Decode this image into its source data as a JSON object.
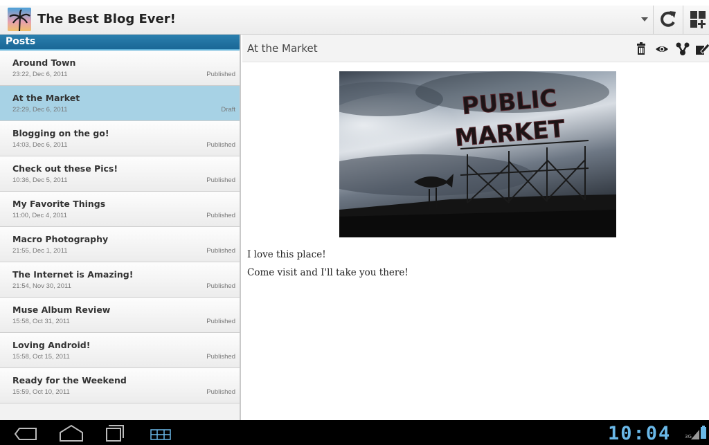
{
  "app": {
    "title": "The Best Blog Ever!"
  },
  "posts_header": "Posts",
  "posts": [
    {
      "title": "Around Town",
      "date": "23:22, Dec 6, 2011",
      "status": "Published",
      "selected": false
    },
    {
      "title": "At the Market",
      "date": "22:29, Dec 6, 2011",
      "status": "Draft",
      "selected": true
    },
    {
      "title": "Blogging on the go!",
      "date": "14:03, Dec 6, 2011",
      "status": "Published",
      "selected": false
    },
    {
      "title": "Check out these Pics!",
      "date": "10:36, Dec 5, 2011",
      "status": "Published",
      "selected": false
    },
    {
      "title": "My Favorite Things",
      "date": "11:00, Dec 4, 2011",
      "status": "Published",
      "selected": false
    },
    {
      "title": "Macro Photography",
      "date": "21:55, Dec 1, 2011",
      "status": "Published",
      "selected": false
    },
    {
      "title": "The Internet is Amazing!",
      "date": "21:54, Nov 30, 2011",
      "status": "Published",
      "selected": false
    },
    {
      "title": "Muse Album Review",
      "date": "15:58, Oct 31, 2011",
      "status": "Published",
      "selected": false
    },
    {
      "title": "Loving Android!",
      "date": "15:58, Oct 15, 2011",
      "status": "Published",
      "selected": false
    },
    {
      "title": "Ready for the Weekend",
      "date": "15:59, Oct 10, 2011",
      "status": "Published",
      "selected": false
    }
  ],
  "detail": {
    "title": "At the Market",
    "photo_sign_text": "PUBLIC MARKET",
    "body_lines": [
      "I love this place!",
      "Come visit and I'll take you there!"
    ]
  },
  "status_bar": {
    "time": "10:04",
    "network": "3G"
  },
  "icons": {
    "dropdown": "chevron-down-icon",
    "refresh": "refresh-icon",
    "new_post": "new-post-icon",
    "delete": "trash-icon",
    "preview": "eye-icon",
    "share": "share-icon",
    "edit": "edit-icon",
    "back": "back-icon",
    "home": "home-icon",
    "recent": "recent-apps-icon",
    "menu": "menu-icon",
    "battery": "battery-icon",
    "signal": "signal-icon"
  },
  "colors": {
    "accent": "#1a6796",
    "selected_row": "#a7d2e5",
    "clock": "#6ab8e8"
  }
}
